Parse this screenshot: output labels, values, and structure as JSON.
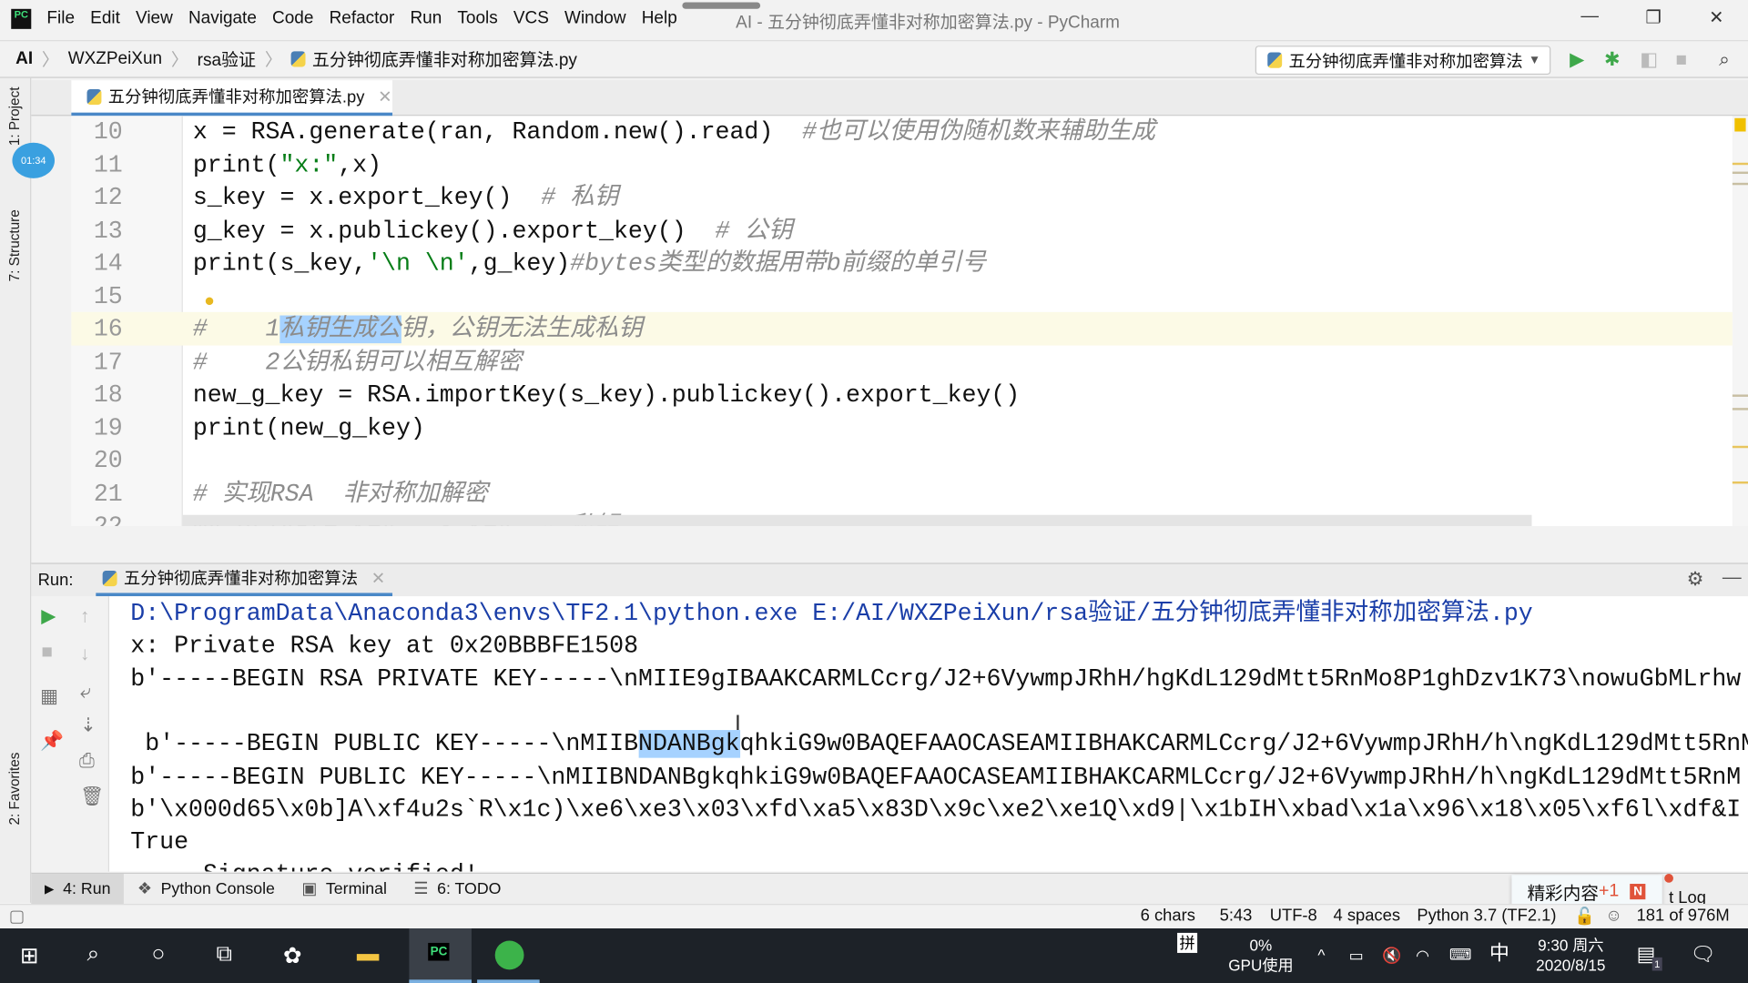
{
  "menu": [
    "File",
    "Edit",
    "View",
    "Navigate",
    "Code",
    "Refactor",
    "Run",
    "Tools",
    "VCS",
    "Window",
    "Help"
  ],
  "window_title": "AI - 五分钟彻底弄懂非对称加密算法.py - PyCharm",
  "breadcrumb": [
    "AI",
    "WXZPeiXun",
    "rsa验证",
    "五分钟彻底弄懂非对称加密算法.py"
  ],
  "run_config": "五分钟彻底弄懂非对称加密算法",
  "left_tools": {
    "project": "1: Project",
    "structure": "7: Structure",
    "favorites": "2: Favorites",
    "timer": "01:34"
  },
  "editor_tab": "五分钟彻底弄懂非对称加密算法.py",
  "code_lines": [
    {
      "n": "10",
      "segs": [
        [
          "x = RSA.generate(ran, Random.new().read)  ",
          ""
        ],
        [
          "#也可以使用伪随机数来辅助生成",
          "c"
        ]
      ]
    },
    {
      "n": "11",
      "segs": [
        [
          "print(",
          ""
        ],
        [
          "\"x:\"",
          "s"
        ],
        [
          ",x)",
          ""
        ]
      ]
    },
    {
      "n": "12",
      "segs": [
        [
          "s_key = x.export_key()  ",
          ""
        ],
        [
          "# 私钥",
          "c"
        ]
      ]
    },
    {
      "n": "13",
      "segs": [
        [
          "g_key = x.publickey().export_key()  ",
          ""
        ],
        [
          "# 公钥",
          "c"
        ]
      ]
    },
    {
      "n": "14",
      "segs": [
        [
          "print(s_key,",
          ""
        ],
        [
          "'\\n \\n'",
          "s"
        ],
        [
          ",g_key)",
          ""
        ],
        [
          "#bytes类型的数据用带b前缀的单引号",
          "c"
        ]
      ]
    },
    {
      "n": "15",
      "segs": []
    },
    {
      "n": "16",
      "segs": [
        [
          "#    1",
          "c"
        ],
        [
          "私钥生成公",
          "c hl"
        ],
        [
          "钥，公钥无法生成私钥",
          "c"
        ]
      ]
    },
    {
      "n": "17",
      "segs": [
        [
          "#    2公钥私钥可以相互解密",
          "c"
        ]
      ]
    },
    {
      "n": "18",
      "segs": [
        [
          "new_g_key = RSA.importKey(s_key).publickey().export_key()",
          ""
        ]
      ]
    },
    {
      "n": "19",
      "segs": [
        [
          "print(new_g_key)",
          ""
        ]
      ]
    },
    {
      "n": "20",
      "segs": []
    },
    {
      "n": "21",
      "segs": [
        [
          "# 实现RSA  非对称加解密",
          "c"
        ]
      ]
    },
    {
      "n": "22",
      "segs": [
        [
          "my_private_key = s_key  ",
          ""
        ],
        [
          "# 私钥",
          "c"
        ]
      ]
    }
  ],
  "run_panel": {
    "label": "Run:",
    "tab": "五分钟彻底弄懂非对称加密算法"
  },
  "console_lines": [
    {
      "segs": [
        [
          "D:\\ProgramData\\Anaconda3\\envs\\TF2.1\\python.exe E:/AI/WXZPeiXun/rsa验证/五分钟彻底弄懂非对称加密算法.py",
          "path"
        ]
      ]
    },
    {
      "segs": [
        [
          "x: Private RSA key at 0x20BBBFE1508",
          ""
        ]
      ]
    },
    {
      "segs": [
        [
          "b'-----BEGIN RSA PRIVATE KEY-----\\nMIIE9gIBAAKCARMLCcrg/J2+6VywmpJRhH/hgKdL129dMtt5RnMo8P1ghDzv1K73\\nowuGbMLrhw",
          ""
        ]
      ]
    },
    {
      "segs": []
    },
    {
      "segs": [
        [
          " b'-----BEGIN PUBLIC KEY-----\\nMIIB",
          ""
        ],
        [
          "NDANBgk",
          "hl"
        ],
        [
          "qhkiG9w0BAQEFAAOCASEAMIIBHAKCARMLCcrg/J2+6VywmpJRhH/h\\ngKdL129dMtt5RnM",
          ""
        ]
      ]
    },
    {
      "segs": [
        [
          "b'-----BEGIN PUBLIC KEY-----\\nMIIBNDANBgkqhkiG9w0BAQEFAAOCASEAMIIBHAKCARMLCcrg/J2+6VywmpJRhH/h\\ngKdL129dMtt5RnM",
          ""
        ]
      ]
    },
    {
      "segs": [
        [
          "b'\\x000d65\\x0b]A\\xf4u2s`R\\x1c)\\xe6\\xe3\\x03\\xfd\\xa5\\x83D\\x9c\\xe2\\xe1Q\\xd9|\\x1bIH\\xbad\\x1a\\x96\\x18\\x05\\xf6l\\xdf&I",
          ""
        ]
      ]
    },
    {
      "segs": [
        [
          "True",
          ""
        ]
      ]
    },
    {
      "segs": [
        [
          "     Signature verified!",
          ""
        ]
      ]
    }
  ],
  "bottom_tabs": [
    "4: Run",
    "Python Console",
    "Terminal",
    "6: TODO"
  ],
  "notification": {
    "text": "精彩内容",
    "count": "+1",
    "event_log": "t Log"
  },
  "status": {
    "selection": "6 chars",
    "position": "5:43",
    "encoding": "UTF-8",
    "indent": "4 spaces",
    "interpreter": "Python 3.7 (TF2.1)",
    "memory": "181 of 976M"
  },
  "taskbar": {
    "ime": "拼",
    "gpu_pct": "0%",
    "gpu_label": "GPU使用",
    "lang": "中",
    "time": "9:30 周六",
    "date": "2020/8/15",
    "notif_count": "1"
  }
}
